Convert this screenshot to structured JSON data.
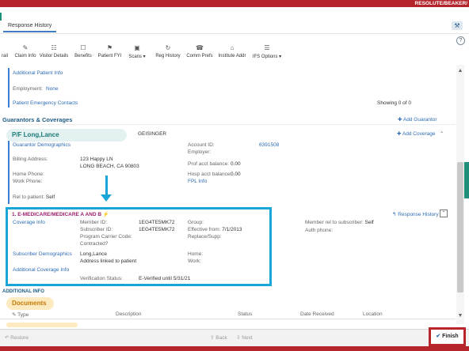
{
  "window": {
    "title": "RESOLUTE/BEAKER/"
  },
  "tab": {
    "label": "Response History"
  },
  "toolbar": {
    "items": [
      {
        "label": "rail",
        "icon": "list-icon"
      },
      {
        "label": "Claim Info",
        "icon": "claim-icon"
      },
      {
        "label": "Visitor Details",
        "icon": "visitor-icon"
      },
      {
        "label": "Benefits",
        "icon": "benefits-icon"
      },
      {
        "label": "Patient FYI",
        "icon": "fyi-icon"
      },
      {
        "label": "Scans",
        "icon": "scans-icon"
      },
      {
        "label": "Reg History",
        "icon": "history-icon"
      },
      {
        "label": "Comm Prefs",
        "icon": "comm-icon"
      },
      {
        "label": "Institute Addr",
        "icon": "institute-icon"
      },
      {
        "label": "IFS Options",
        "icon": "options-icon"
      }
    ]
  },
  "patient_info": {
    "additional_link": "Additional Patient Info",
    "employment_label": "Employment:",
    "employment_value": "None",
    "emergency_link": "Patient Emergency Contacts",
    "showing": "Showing 0 of 0"
  },
  "guarantors": {
    "title": "Guarantors & Coverages",
    "add_guarantor": "Add Guarantor",
    "add_coverage": "Add Coverage",
    "pf_name": "P/F Long,Lance",
    "payer": "GEISINGER",
    "demographics_link": "Guarantor Demographics",
    "billing_label": "Billing Address:",
    "billing_line1": "123 Happy LN",
    "billing_line2": "LONG BEACH, CA 90803",
    "home_phone_label": "Home Phone:",
    "work_phone_label": "Work Phone:",
    "rel_label": "Rel to patient:",
    "rel_value": "Self",
    "account_id_label": "Account ID:",
    "account_id_value": "6391508",
    "employer_label": "Employer:",
    "prof_balance_label": "Prof acct balance:",
    "prof_balance_value": "0.00",
    "hosp_balance_label": "Hosp acct balance:",
    "hosp_balance_value": "0.00",
    "fpl_link": "FPL Info"
  },
  "coverage": {
    "title": "1. E-MEDICARE/MEDICARE A AND B",
    "response_history_link": "Response History",
    "coverage_info_link": "Coverage Info",
    "subscriber_demographics_link": "Subscriber Demographics",
    "additional_coverage_link": "Additional Coverage Info",
    "member_id_label": "Member ID:",
    "member_id_value": "1EG4TE5MK72",
    "subscriber_id_label": "Subscriber ID:",
    "subscriber_id_value": "1EG4TE5MK72",
    "program_carrier_label": "Program Carrier Code:",
    "contracted_label": "Contracted?",
    "group_label": "Group:",
    "effective_label": "Effective from:",
    "effective_value": "7/1/2013",
    "replace_label": "Replace/Supp:",
    "subscriber_name": "Long,Lance",
    "address_linked": "Address linked to patient",
    "home_label": "Home:",
    "work_label": "Work:",
    "verification_label": "Verification Status:",
    "verification_value": "E-Verified until 5/31/21",
    "member_rel_label": "Member rel to subscriber:",
    "member_rel_value": "Self",
    "auth_phone_label": "Auth phone:"
  },
  "additional_info": {
    "title": "ADDITIONAL INFO"
  },
  "documents": {
    "title": "Documents",
    "columns": [
      "Type",
      "Description",
      "Status",
      "Date Received",
      "Location"
    ]
  },
  "bottom": {
    "restore": "Restore",
    "back": "Back",
    "next": "Next",
    "finish": "Finish"
  },
  "colors": {
    "brand_red": "#b3252b",
    "highlight_blue": "#1aa5d8",
    "link_blue": "#2d6cb5",
    "coverage_magenta": "#9b1c6c"
  }
}
